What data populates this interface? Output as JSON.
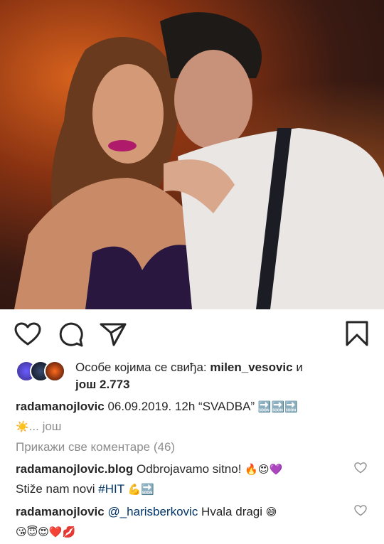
{
  "post": {
    "image_alt": "photo-of-couple",
    "actions": {
      "like_icon": "heart-icon",
      "comment_icon": "comment-icon",
      "share_icon": "send-icon",
      "save_icon": "bookmark-icon"
    },
    "likes": {
      "prefix": "Особе којима се свиђа: ",
      "user": "milen_vesovic",
      "middle": " и",
      "count_text": "још 2.773"
    },
    "caption": {
      "username": "radamanojlovic",
      "text": " 06.09.2019. 12h “SVADBA” ",
      "emoji_tail": "🔜🔜🔜",
      "emoji_sun": "☀️",
      "more": "... још"
    },
    "view_all_comments": "Прикажи све коментаре (46)",
    "comments": [
      {
        "username": "radamanojlovic.blog",
        "text": " Odbrojavamo sitno! ",
        "emoji": "🔥😍💜",
        "line2_text": "Stiže nam novi ",
        "hashtag": "#HIT",
        "line2_emoji": "💪🔜"
      },
      {
        "username": "radamanojlovic",
        "mention": "@_harisberkovic",
        "text": " Hvala dragi ",
        "emoji": "😅",
        "line2_emoji": "😘😇😍❤️💋"
      }
    ]
  },
  "colors": {
    "text": "#262626",
    "muted": "#8e8e8e",
    "link": "#003569"
  }
}
